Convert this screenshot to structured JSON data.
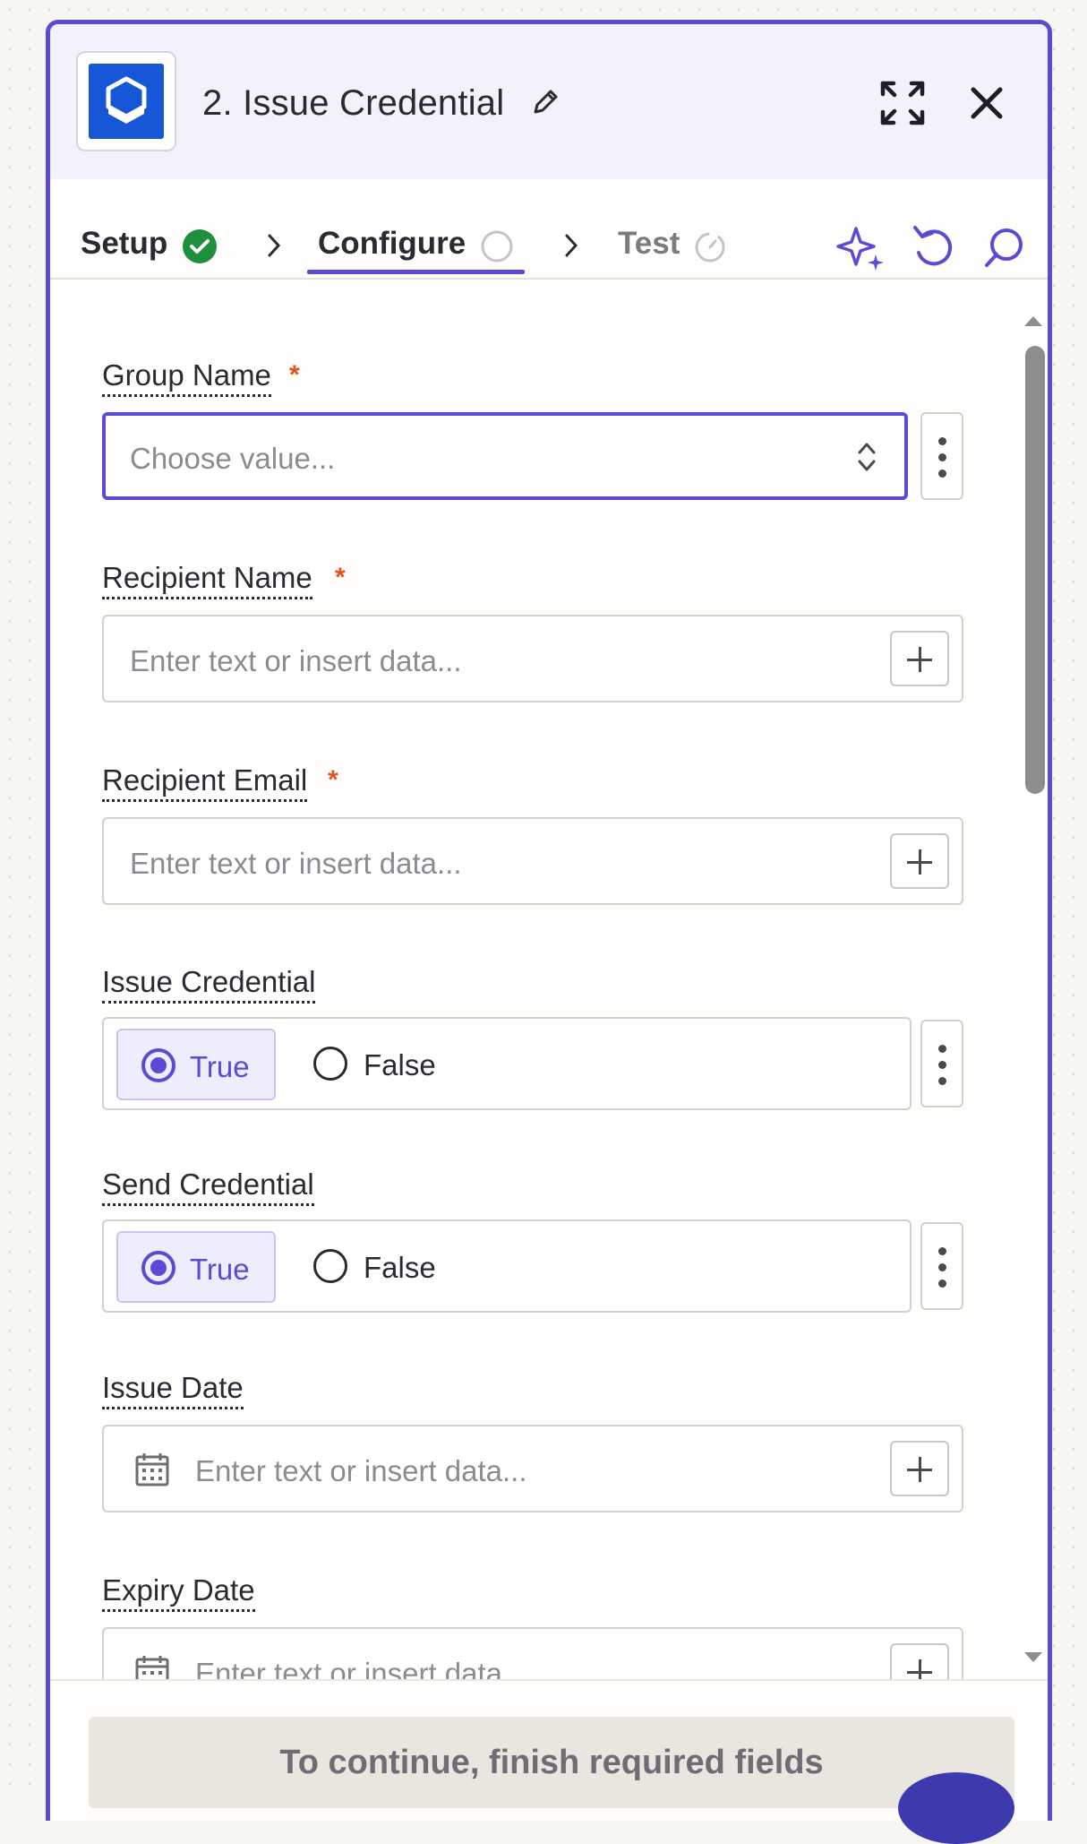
{
  "header": {
    "title": "2. Issue Credential",
    "app_icon": "certifier-shield-icon"
  },
  "tabs": [
    {
      "label": "Setup",
      "status": "complete"
    },
    {
      "label": "Configure",
      "status": "active"
    },
    {
      "label": "Test",
      "status": "pending"
    }
  ],
  "fields": {
    "group_name": {
      "label": "Group Name",
      "required": "*",
      "placeholder": "Choose value..."
    },
    "recipient_name": {
      "label": "Recipient Name",
      "required": "*",
      "placeholder": "Enter text or insert data..."
    },
    "recipient_email": {
      "label": "Recipient Email",
      "required": "*",
      "placeholder": "Enter text or insert data..."
    },
    "issue_credential": {
      "label": "Issue Credential",
      "options": [
        "True",
        "False"
      ],
      "selected": "True"
    },
    "send_credential": {
      "label": "Send Credential",
      "options": [
        "True",
        "False"
      ],
      "selected": "True"
    },
    "issue_date": {
      "label": "Issue Date",
      "placeholder": "Enter text or insert data..."
    },
    "expiry_date": {
      "label": "Expiry Date",
      "placeholder": "Enter text or insert data..."
    }
  },
  "footer": {
    "continue_label": "To continue, finish required fields"
  },
  "colors": {
    "accent": "#5a4bd6",
    "success": "#1e8f3a",
    "required": "#e2561e",
    "app_brand": "#1557d6"
  }
}
